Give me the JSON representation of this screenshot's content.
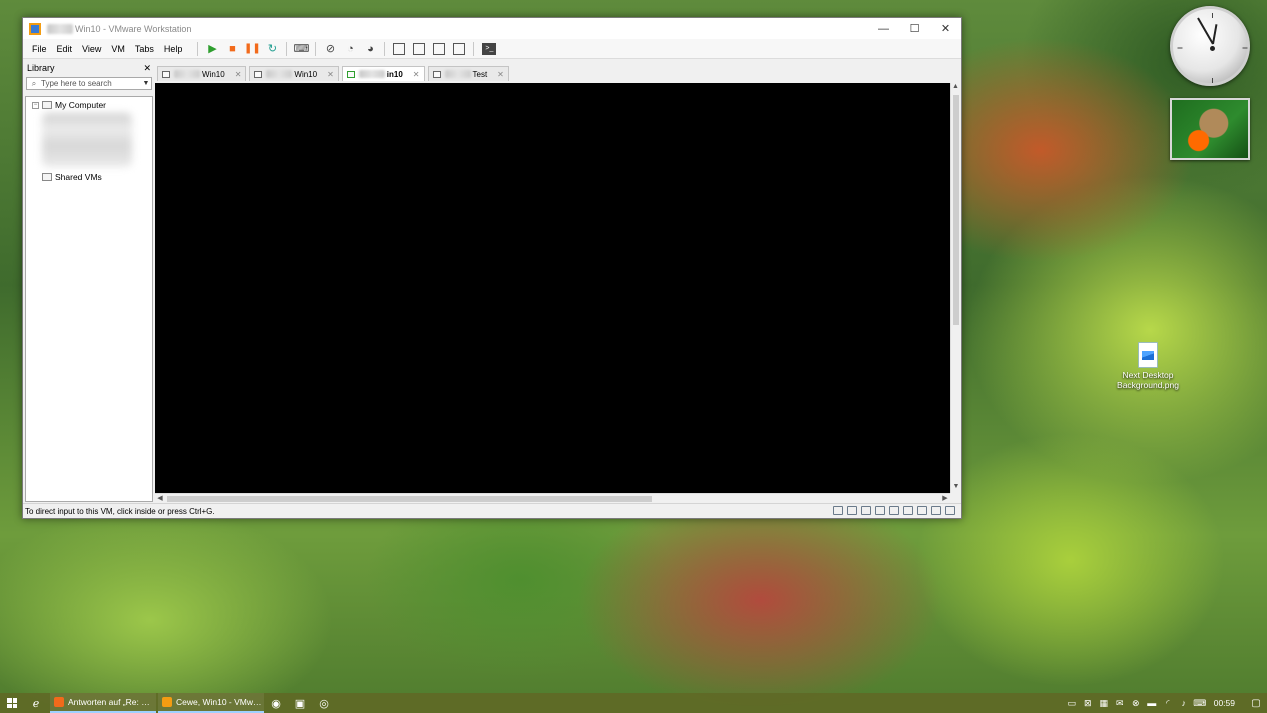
{
  "window": {
    "title_suffix": "Win10 - VMware Workstation",
    "controls": {
      "minimize": "—",
      "maximize": "☐",
      "close": "✕"
    }
  },
  "menu": [
    "File",
    "Edit",
    "View",
    "VM",
    "Tabs",
    "Help"
  ],
  "library": {
    "title": "Library",
    "close": "✕",
    "search_placeholder": "Type here to search",
    "tree": {
      "my_computer": "My Computer",
      "shared_vms": "Shared VMs"
    }
  },
  "tabs": [
    {
      "label": "Win10",
      "close": "✕",
      "active": false
    },
    {
      "label": "Win10",
      "close": "✕",
      "active": false
    },
    {
      "label": "in10",
      "close": "✕",
      "active": true
    },
    {
      "label": "Test",
      "close": "✕",
      "active": false
    }
  ],
  "status": {
    "message": "To direct input to this VM, click inside or press Ctrl+G."
  },
  "desktop": {
    "icon_label": "Next Desktop Background.png"
  },
  "taskbar": {
    "tasks": [
      {
        "label": "Antworten auf „Re: W...",
        "icon_color": "#f26a1b"
      },
      {
        "label": "Cewe, Win10 - VMwa...",
        "icon_color": "#f39c12"
      }
    ],
    "clock": "00:59"
  }
}
